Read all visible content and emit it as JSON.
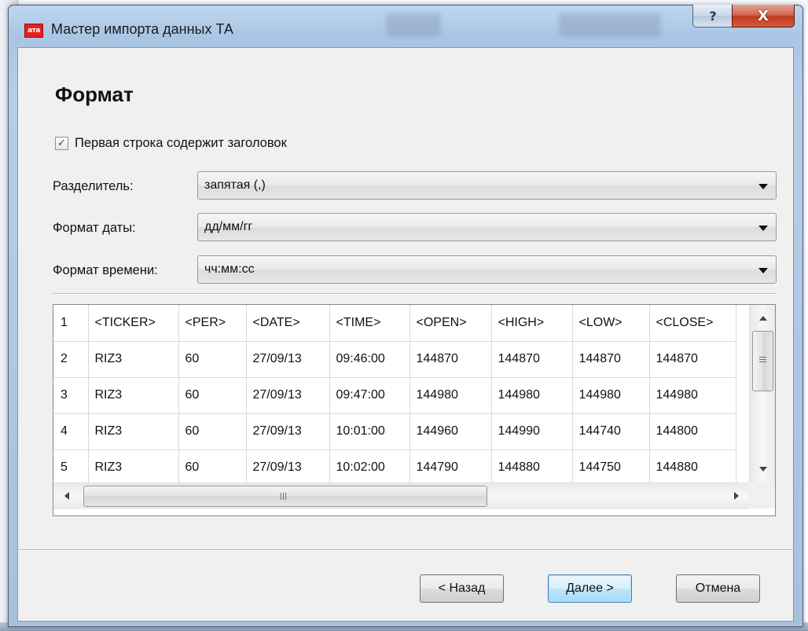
{
  "window": {
    "title": "Мастер импорта данных ТА",
    "icon_label": "ата",
    "help_glyph": "?",
    "close_glyph": "X"
  },
  "page": {
    "title": "Формат"
  },
  "options": {
    "header_checkbox": {
      "label": "Первая строка содержит заголовок",
      "checked": true,
      "check_glyph": "✓"
    },
    "separator": {
      "label": "Разделитель:",
      "value": "запятая (,)"
    },
    "date_format": {
      "label": "Формат даты:",
      "value": "дд/мм/гг"
    },
    "time_format": {
      "label": "Формат времени:",
      "value": "чч:мм:сс"
    }
  },
  "preview": {
    "rows": [
      [
        "1",
        "<TICKER>",
        "<PER>",
        "<DATE>",
        "<TIME>",
        "<OPEN>",
        "<HIGH>",
        "<LOW>",
        "<CLOSE>"
      ],
      [
        "2",
        "RIZ3",
        "60",
        "27/09/13",
        "09:46:00",
        "144870",
        "144870",
        "144870",
        "144870"
      ],
      [
        "3",
        "RIZ3",
        "60",
        "27/09/13",
        "09:47:00",
        "144980",
        "144980",
        "144980",
        "144980"
      ],
      [
        "4",
        "RIZ3",
        "60",
        "27/09/13",
        "10:01:00",
        "144960",
        "144990",
        "144740",
        "144800"
      ],
      [
        "5",
        "RIZ3",
        "60",
        "27/09/13",
        "10:02:00",
        "144790",
        "144880",
        "144750",
        "144880"
      ]
    ]
  },
  "buttons": {
    "back": "< Назад",
    "next": "Далее >",
    "cancel": "Отмена"
  },
  "colors": {
    "close_button": "#c8452b",
    "title_bar": "#a9c5e5",
    "dialog_background": "#f0f0f0"
  }
}
